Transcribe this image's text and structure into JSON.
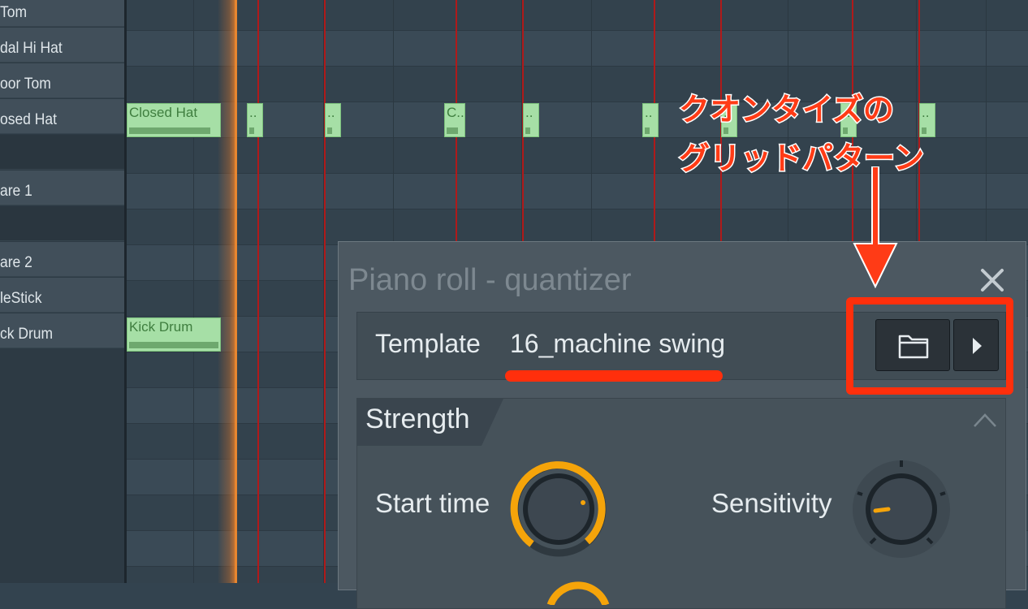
{
  "instruments": [
    {
      "label": "Tom"
    },
    {
      "label": "dal Hi Hat"
    },
    {
      "label": "oor Tom"
    },
    {
      "label": "osed Hat"
    },
    {
      "label": ""
    },
    {
      "label": "are 1"
    },
    {
      "label": ""
    },
    {
      "label": "are 2"
    },
    {
      "label": "leStick"
    },
    {
      "label": "ck Drum"
    }
  ],
  "notes": {
    "closed_hat_main": "Closed Hat",
    "closed_hat_short": "C..",
    "dots": "..",
    "kick_drum": "Kick Drum"
  },
  "dialog": {
    "title": "Piano roll - quantizer",
    "template_label": "Template",
    "template_value": "16_machine swing",
    "folder_icon": "folder-icon",
    "next_icon": "play-arrow-icon",
    "strength_label": "Strength",
    "start_time_label": "Start time",
    "sensitivity_label": "Sensitivity"
  },
  "annotation": {
    "line1": "クオンタイズの",
    "line2": "グリッドパターン"
  },
  "colors": {
    "annotation": "#ff3b16",
    "knob_accent": "#f5a40a",
    "note": "#a6dfa6",
    "bar_line": "#b01a1a",
    "playhead": "#e8862f"
  }
}
